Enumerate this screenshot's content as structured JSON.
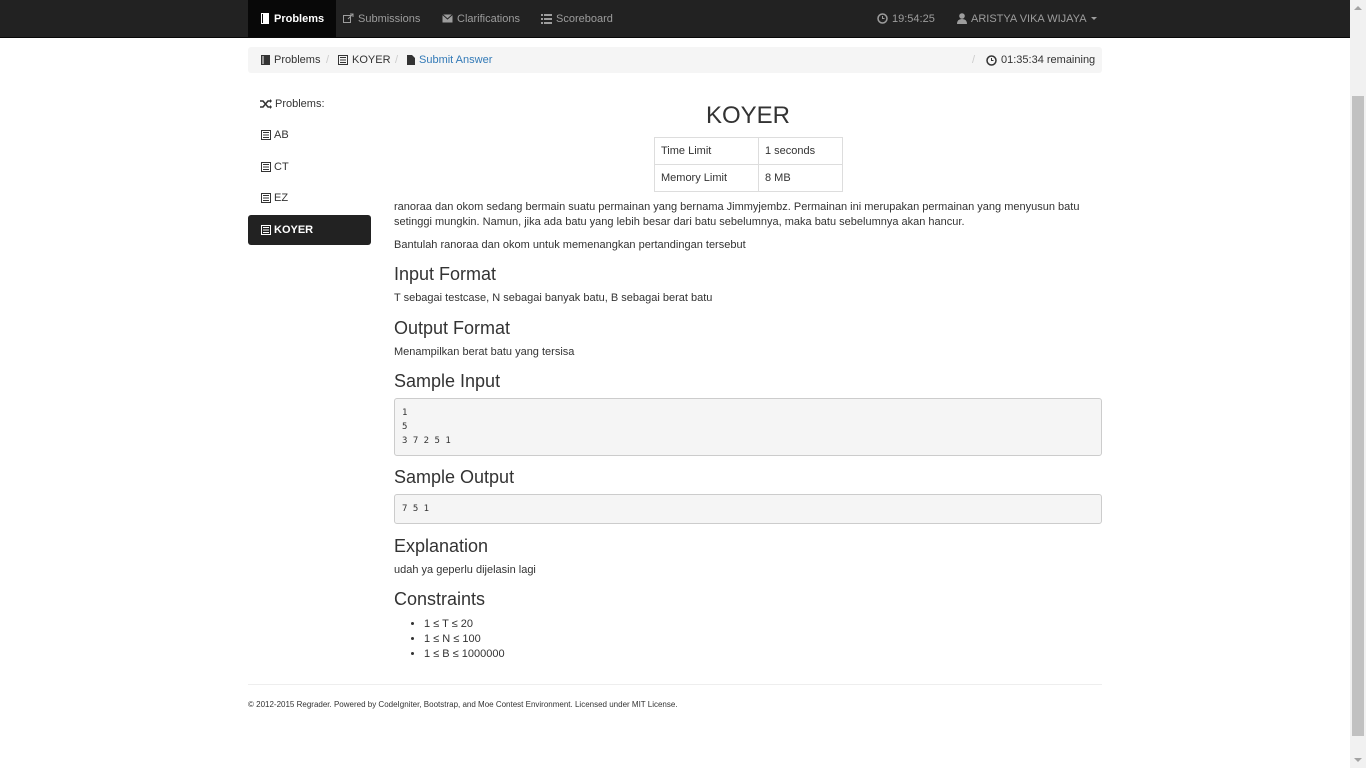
{
  "navbar": {
    "items": [
      {
        "label": "Problems",
        "icon": "book-icon",
        "active": true
      },
      {
        "label": "Submissions",
        "icon": "share-icon"
      },
      {
        "label": "Clarifications",
        "icon": "envelope-icon"
      },
      {
        "label": "Scoreboard",
        "icon": "list-icon"
      }
    ],
    "clock": "19:54:25",
    "user": "ARISTYA VIKA WIJAYA"
  },
  "breadcrumb": {
    "items": [
      {
        "label": "Problems",
        "icon": "book-icon"
      },
      {
        "label": "KOYER",
        "icon": "list-alt-icon"
      },
      {
        "label": "Submit Answer",
        "icon": "file-icon"
      }
    ],
    "separator": "/",
    "remaining": "01:35:34 remaining"
  },
  "sidebar": {
    "title": "Problems:",
    "items": [
      {
        "label": "AB"
      },
      {
        "label": "CT"
      },
      {
        "label": "EZ"
      },
      {
        "label": "KOYER",
        "active": true
      }
    ]
  },
  "problem": {
    "title": "KOYER",
    "limits": [
      {
        "name": "Time Limit",
        "value": "1 seconds"
      },
      {
        "name": "Memory Limit",
        "value": "8 MB"
      }
    ],
    "description": [
      "ranoraa dan okom sedang bermain suatu permainan yang bernama Jimmyjembz. Permainan ini merupakan permainan yang menyusun batu setinggi mungkin. Namun, jika ada batu yang lebih besar dari batu sebelumnya, maka batu sebelumnya akan hancur.",
      "Bantulah ranoraa dan okom untuk memenangkan pertandingan tersebut"
    ],
    "input_format_heading": "Input Format",
    "input_format": "T sebagai testcase, N sebagai banyak batu, B sebagai berat batu",
    "output_format_heading": "Output Format",
    "output_format": "Menampilkan berat batu yang tersisa",
    "sample_input_heading": "Sample Input",
    "sample_input": "1\n5\n3 7 2 5 1",
    "sample_output_heading": "Sample Output",
    "sample_output": "7 5 1",
    "explanation_heading": "Explanation",
    "explanation": "udah ya geperlu dijelasin lagi",
    "constraints_heading": "Constraints",
    "constraints": [
      "1 ≤ T ≤ 20",
      "1 ≤ N ≤ 100",
      "1 ≤ B ≤ 1000000"
    ]
  },
  "footer": "© 2012-2015 Regrader. Powered by CodeIgniter, Bootstrap, and Moe Contest Environment. Licensed under MIT License.",
  "colors": {
    "navbar": "#222222",
    "link": "#337ab7",
    "active_bg": "#080808"
  }
}
